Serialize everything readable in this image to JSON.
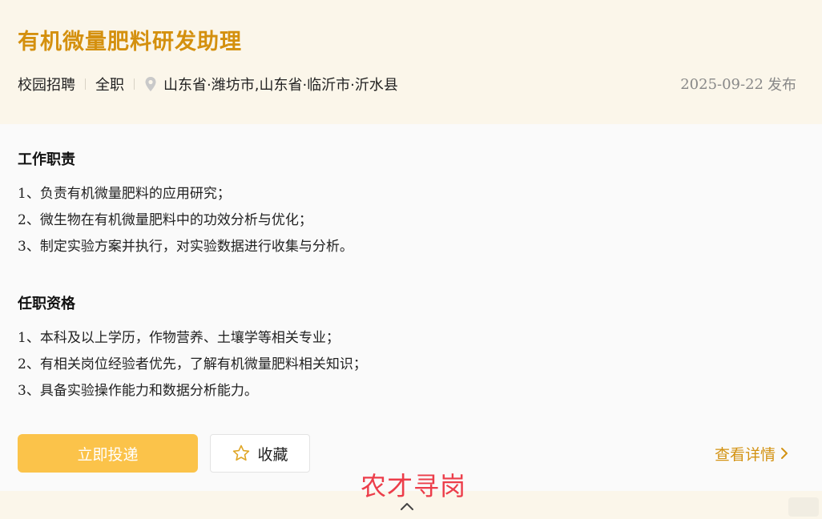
{
  "job": {
    "title": "有机微量肥料研发助理",
    "recruit_type": "校园招聘",
    "employment_type": "全职",
    "location": "山东省·潍坊市,山东省·临沂市·沂水县",
    "date": "2025-09-22",
    "date_suffix": "发布"
  },
  "duties": {
    "title": "工作职责",
    "items": [
      {
        "num": "1",
        "text": "、负责有机微量肥料的应用研究；"
      },
      {
        "num": "2",
        "text": "、微生物在有机微量肥料中的功效分析与优化；"
      },
      {
        "num": "3",
        "text": "、制定实验方案并执行，对实验数据进行收集与分析。"
      }
    ]
  },
  "requirements": {
    "title": "任职资格",
    "items": [
      {
        "num": "1",
        "text": "、本科及以上学历，作物营养、土壤学等相关专业；"
      },
      {
        "num": "2",
        "text": "、有相关岗位经验者优先，了解有机微量肥料相关知识；"
      },
      {
        "num": "3",
        "text": "、具备实验操作能力和数据分析能力。"
      }
    ]
  },
  "actions": {
    "apply_label": "立即投递",
    "favorite_label": "收藏",
    "details_label": "查看详情"
  },
  "watermark": "农才寻岗",
  "colors": {
    "accent": "#d4900e",
    "apply_button": "#fbc34a",
    "watermark": "#ec3d4a"
  },
  "icons": {
    "location": "map-pin-icon",
    "favorite": "star-outline-icon",
    "details": "chevron-right-icon",
    "collapse": "chevron-up-icon"
  }
}
